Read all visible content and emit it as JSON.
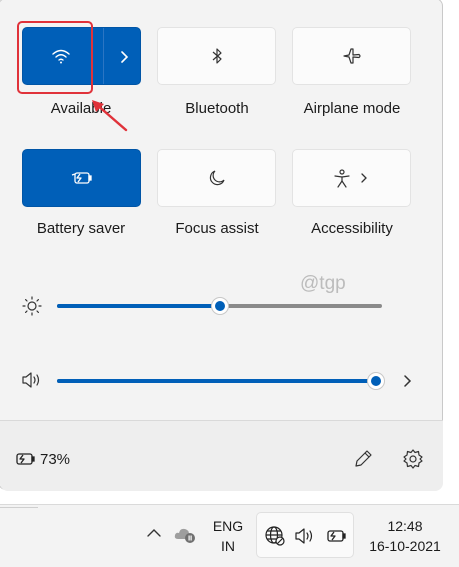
{
  "quick_settings": {
    "tiles": [
      {
        "label": "Available",
        "icon": "wifi-icon",
        "active": true,
        "has_arrow": true
      },
      {
        "label": "Bluetooth",
        "icon": "bluetooth-icon",
        "active": false
      },
      {
        "label": "Airplane mode",
        "icon": "airplane-icon",
        "active": false
      },
      {
        "label": "Battery saver",
        "icon": "battery-saver-icon",
        "active": true
      },
      {
        "label": "Focus assist",
        "icon": "moon-icon",
        "active": false
      },
      {
        "label": "Accessibility",
        "icon": "accessibility-icon",
        "active": false,
        "has_arrow": true
      }
    ],
    "brightness": {
      "icon": "sun-icon",
      "level": 0.5
    },
    "volume": {
      "icon": "speaker-icon",
      "level": 0.98
    }
  },
  "watermark": "@tgp",
  "footer": {
    "battery_percent": "73%",
    "battery_icon": "battery-charging-icon",
    "edit_icon": "pencil-icon",
    "settings_icon": "gear-icon"
  },
  "taskbar": {
    "language_line1": "ENG",
    "language_line2": "IN",
    "time": "12:48",
    "date": "16-10-2021",
    "tray_icons": [
      "chevron-up-icon",
      "onedrive-icon",
      "network-globe-icon",
      "speaker-icon",
      "battery-icon"
    ]
  },
  "colors": {
    "accent": "#005fb8",
    "highlight": "#e0323a"
  }
}
